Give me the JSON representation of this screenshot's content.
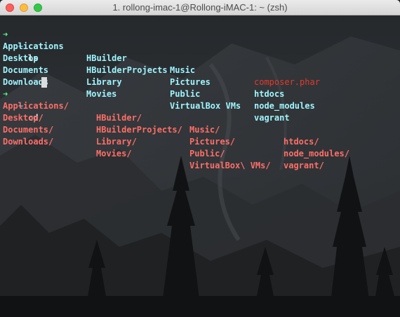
{
  "window": {
    "title": "1. rollong-imac-1@Rollong-iMAC-1: ~ (zsh)"
  },
  "prompt": {
    "arrow": "➜",
    "path": "~"
  },
  "commands": [
    {
      "text": "ls"
    },
    {
      "text": "cd"
    }
  ],
  "ls_output": {
    "rows": [
      [
        "Applications",
        "HBuilder",
        "Music",
        "composer.phar"
      ],
      [
        "Desktop",
        "HBuilderProjects",
        "Pictures",
        "htdocs"
      ],
      [
        "Documents",
        "Library",
        "Public",
        "node_modules"
      ],
      [
        "Downloads",
        "Movies",
        "VirtualBox VMs",
        "vagrant"
      ]
    ]
  },
  "cd_completions": {
    "rows": [
      [
        "Applications/",
        "HBuilder/",
        "Music/",
        "htdocs/"
      ],
      [
        "Desktop/",
        "HBuilderProjects/",
        "Pictures/",
        "node_modules/"
      ],
      [
        "Documents/",
        "Library/",
        "Public/",
        "vagrant/"
      ],
      [
        "Downloads/",
        "Movies/",
        "VirtualBox\\ VMs/",
        ""
      ]
    ]
  },
  "colors": {
    "prompt_arrow": "#5af78e",
    "prompt_path": "#57c7ff",
    "directory": "#9ef5ff",
    "file": "#e33a2c",
    "completion": "#ff6e67"
  }
}
